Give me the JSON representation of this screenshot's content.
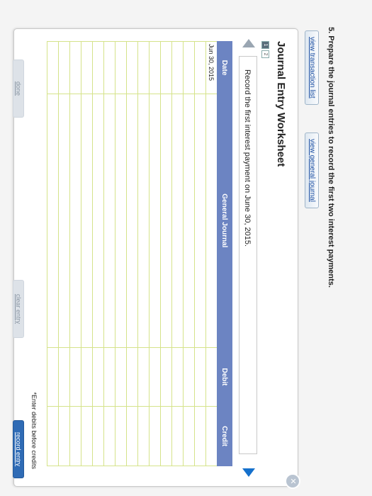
{
  "question": {
    "label": "5. Prepare the journal entries to record the first two interest payments."
  },
  "toolbar": {
    "view_transaction_list": "view transaction list",
    "view_general_journal": "view general journal"
  },
  "worksheet": {
    "title": "Journal Entry Worksheet",
    "pages": [
      "1",
      "2"
    ],
    "active_page": "1",
    "entry_description": "Record the first interest payment on June 30, 2015.",
    "close_glyph": "✕"
  },
  "journal": {
    "columns": [
      "Date",
      "General Journal",
      "Debit",
      "Credit"
    ],
    "rows": [
      [
        "Jun 30, 2015",
        "",
        "",
        ""
      ],
      [
        "",
        "",
        "",
        ""
      ],
      [
        "",
        "",
        "",
        ""
      ],
      [
        "",
        "",
        "",
        ""
      ],
      [
        "",
        "",
        "",
        ""
      ],
      [
        "",
        "",
        "",
        ""
      ],
      [
        "",
        "",
        "",
        ""
      ],
      [
        "",
        "",
        "",
        ""
      ],
      [
        "",
        "",
        "",
        ""
      ],
      [
        "",
        "",
        "",
        ""
      ],
      [
        "",
        "",
        "",
        ""
      ],
      [
        "",
        "",
        "",
        ""
      ],
      [
        "",
        "",
        "",
        ""
      ],
      [
        "",
        "",
        "",
        ""
      ],
      [
        "",
        "",
        "",
        ""
      ]
    ]
  },
  "note": "*Enter debits before credits",
  "buttons": {
    "done": "done",
    "clear_entry": "clear entry",
    "record_entry": "record entry"
  },
  "colors": {
    "header_blue": "#6c84c2",
    "grid_green": "#d5e38a",
    "record_button": "#2f6bb5",
    "next_arrow": "#1570cc"
  }
}
